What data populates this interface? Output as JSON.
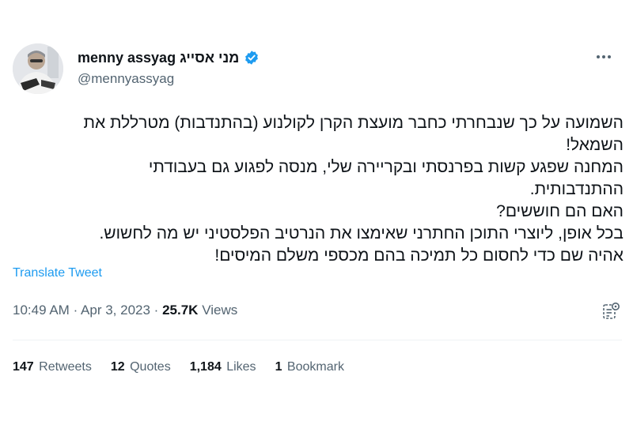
{
  "author": {
    "display_name": "menny assyag מני אסייג",
    "handle": "@mennyassyag",
    "verified_icon": "verified-badge-icon",
    "verified_color": "#1d9bf0"
  },
  "tweet": {
    "lines": [
      "השמועה על כך שנבחרתי כחבר מועצת הקרן לקולנוע (בהתנדבות) מטרללת את",
      "השמאל!",
      "המחנה שפגע קשות בפרנסתי ובקריירה שלי, מנסה לפגוע גם בעבודתי",
      "ההתנדבותית.",
      "האם הם חוששים?",
      "בכל אופן, ליוצרי התוכן החתרני שאימצו את הנרטיב הפלסטיני יש מה לחשוש.",
      "אהיה שם כדי לחסום כל תמיכה בהם מכספי משלם המיסים!"
    ],
    "translate_label": "Translate Tweet"
  },
  "meta": {
    "time": "10:49 AM",
    "separator": "·",
    "date": "Apr 3, 2023",
    "views_count": "25.7K",
    "views_label": "Views"
  },
  "stats": {
    "retweets_count": "147",
    "retweets_label": "Retweets",
    "quotes_count": "12",
    "quotes_label": "Quotes",
    "likes_count": "1,184",
    "likes_label": "Likes",
    "bookmarks_count": "1",
    "bookmarks_label": "Bookmark"
  },
  "colors": {
    "link": "#1d9bf0",
    "secondary_text": "#536471",
    "divider": "#eff3f4"
  }
}
